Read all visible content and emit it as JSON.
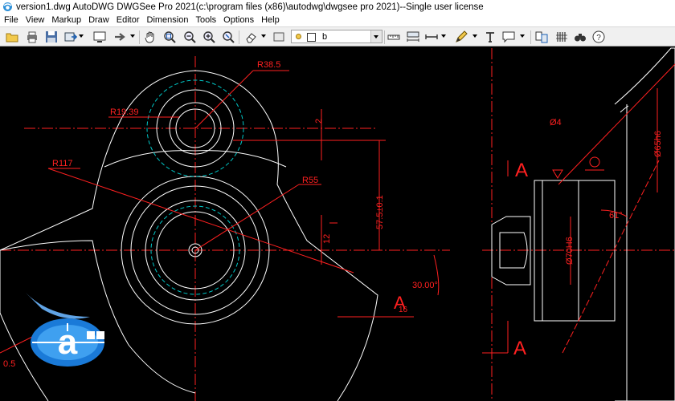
{
  "window": {
    "title": "version1.dwg AutoDWG DWGSee Pro 2021(c:\\program files (x86)\\autodwg\\dwgsee pro 2021)--Single user license"
  },
  "menu": {
    "items": [
      "File",
      "View",
      "Markup",
      "Draw",
      "Editor",
      "Dimension",
      "Tools",
      "Options",
      "Help"
    ]
  },
  "toolbar": {
    "layer_value": "b",
    "icons": [
      "open-folder-icon",
      "print-icon",
      "save-icon",
      "export-icon",
      "display-icon",
      "forward-arrow-icon",
      "pan-hand-icon",
      "zoom-window-icon",
      "zoom-out-icon",
      "zoom-in-icon",
      "zoom-realtime-icon",
      "eraser-icon",
      "rectangle-icon",
      "layer-icon",
      "measure-icon",
      "dimension-icon",
      "linear-dimension-icon",
      "pen-icon",
      "text-icon",
      "comment-icon",
      "compare-icon",
      "hatch-icon",
      "binoculars-icon",
      "help-icon"
    ]
  },
  "drawing": {
    "dims": {
      "r38_5": "R38.5",
      "r19_39": "R19.39",
      "r117": "R117",
      "r55": "R55",
      "d2": "2",
      "d57": "57.5±0.1",
      "d12": "12",
      "a30": "30.00°",
      "d16": "16",
      "left_cut": "0.5",
      "d04": "Ø4",
      "d65": "Ø65h6",
      "a61": "61°",
      "d70": "Ø70H6",
      "sec_a1": "A",
      "sec_a2": "A",
      "sec_a3": "A"
    },
    "colors": {
      "background": "#000000",
      "outline": "#ffffff",
      "dimension": "#ff2020",
      "hidden": "#00c8c8"
    }
  }
}
